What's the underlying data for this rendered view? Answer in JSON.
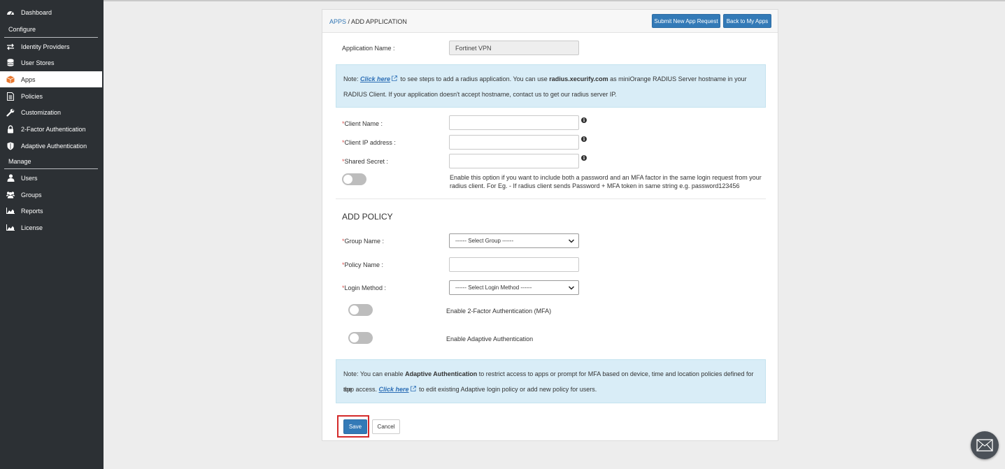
{
  "sidebar": {
    "dashboard": "Dashboard",
    "configure": "Configure",
    "identity_providers": "Identity Providers",
    "user_stores": "User Stores",
    "apps": "Apps",
    "policies": "Policies",
    "customization": "Customization",
    "two_factor": "2-Factor Authentication",
    "adaptive": "Adaptive Authentication",
    "manage": "Manage",
    "users": "Users",
    "groups": "Groups",
    "reports": "Reports",
    "license": "License"
  },
  "header": {
    "crumb_apps": "APPS",
    "crumb_sep": " / ",
    "crumb_page": "ADD APPLICATION",
    "submit_btn": "Submit New App Request",
    "back_btn": "Back to My Apps"
  },
  "form": {
    "app_name_label": "Application Name :",
    "app_name_value": "Fortinet VPN",
    "note1_prefix": "Note: ",
    "note1_link": "Click here",
    "note1_text_a": " to see steps to add a radius application. You can use ",
    "note1_bold": "radius.xecurify.com",
    "note1_text_b": " as miniOrange RADIUS Server hostname in your",
    "note1_line2": "RADIUS Client. If your application doesn't accept hostname, contact us to get our radius server IP.",
    "required_mark": "*",
    "client_name_label": "Client Name :",
    "client_ip_label": "Client IP address :",
    "shared_secret_label": "Shared Secret :",
    "info_glyph": "i",
    "password_mfa_text1": "Enable this option if you want to include both a password and an MFA factor in the same login request from your",
    "password_mfa_text2": "radius client. For Eg. - If radius client sends Password + MFA token in same string e.g. password123456"
  },
  "policy": {
    "heading": "ADD POLICY",
    "group_name_label": "Group Name :",
    "group_name_selected": "------ Select Group ------",
    "policy_name_label": "Policy Name :",
    "login_method_label": "Login Method :",
    "login_method_selected": "------ Select Login Method ------",
    "mfa_toggle_label": "Enable 2-Factor Authentication (MFA)",
    "adaptive_toggle_label": "Enable Adaptive Authentication",
    "note2_prefix": "Note: You can enable ",
    "note2_bold": "Adaptive Authentication",
    "note2_text": " to restrict access to apps or prompt for MFA based on device, time and location policies defined for the",
    "note2_line2_a": "app access. ",
    "note2_link": "Click here",
    "note2_line2_b": " to edit existing Adaptive login policy or add new policy for users."
  },
  "actions": {
    "save": "Save",
    "cancel": "Cancel"
  },
  "colors": {
    "sidebar_bg": "#2c3034",
    "primary": "#337ab7",
    "note_bg": "#d9edf7",
    "apps_icon": "#e8772e",
    "highlight": "#d42a2a"
  },
  "icons": {
    "dashboard": "dashboard-icon",
    "identity_providers": "exchange-icon",
    "user_stores": "database-icon",
    "apps": "cube-icon",
    "policies": "document-icon",
    "customization": "wrench-icon",
    "two_factor": "lock-icon",
    "adaptive": "shield-icon",
    "users": "user-icon",
    "groups": "users-icon",
    "reports": "area-chart-icon",
    "license": "area-chart-icon",
    "chat": "envelope-icon"
  }
}
